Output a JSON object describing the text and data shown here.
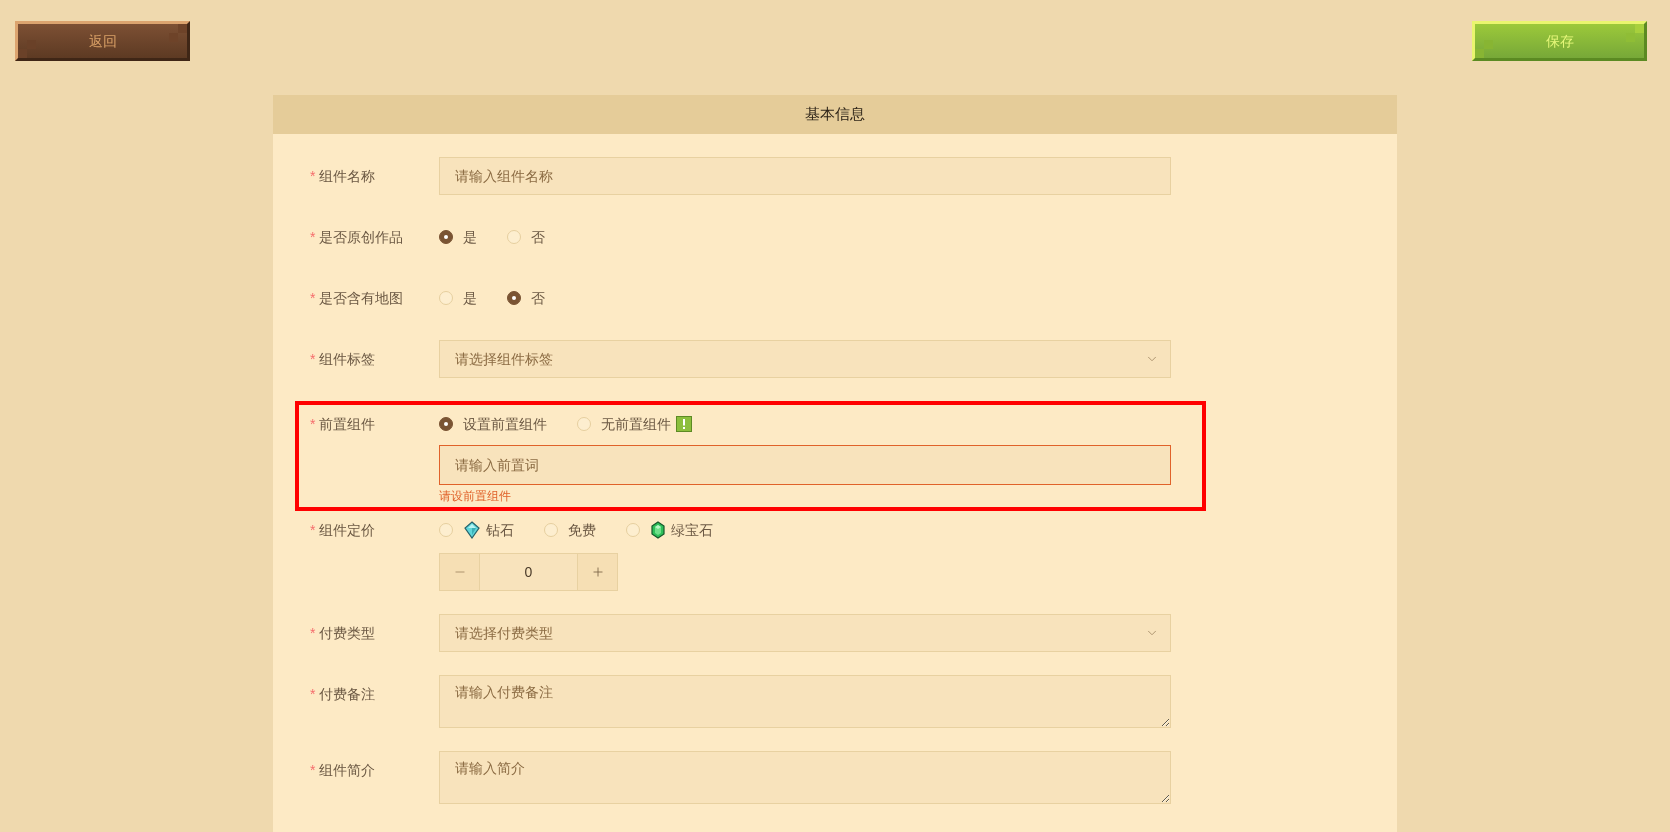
{
  "top_bar": {
    "back_button": "返回",
    "save_button": "保存"
  },
  "panel": {
    "title": "基本信息",
    "fields": [
      {
        "kind": "input",
        "required_mark": "*",
        "label": "组件名称",
        "placeholder": "请输入组件名称"
      },
      {
        "kind": "radio",
        "required_mark": "*",
        "label": "是否原创作品",
        "options": [
          {
            "kind": "plain",
            "label": "是",
            "selected": true
          },
          {
            "kind": "plain",
            "label": "否",
            "selected": false
          }
        ]
      },
      {
        "kind": "radio",
        "required_mark": "*",
        "label": "是否含有地图",
        "options": [
          {
            "kind": "plain",
            "label": "是",
            "selected": false
          },
          {
            "kind": "plain",
            "label": "否",
            "selected": true
          }
        ]
      },
      {
        "kind": "select",
        "required_mark": "*",
        "label": "组件标签",
        "placeholder": "请选择组件标签"
      },
      {
        "kind": "radio_input",
        "required_mark": "*",
        "label": "前置组件",
        "highlighted": true,
        "options": [
          {
            "kind": "plain",
            "label": "设置前置组件",
            "selected": true
          },
          {
            "kind": "warning",
            "label": "无前置组件",
            "selected": false
          }
        ],
        "input": {
          "placeholder": "请输入前置词",
          "error": true
        },
        "error_message": "请设前置组件"
      },
      {
        "kind": "price",
        "required_mark": "*",
        "label": "组件定价",
        "options": [
          {
            "kind": "diamond",
            "label": "钻石",
            "selected": false
          },
          {
            "kind": "plain",
            "label": "免费",
            "selected": false
          },
          {
            "kind": "emerald",
            "label": "绿宝石",
            "selected": false
          }
        ],
        "stepper": {
          "value": "0"
        }
      },
      {
        "kind": "select",
        "required_mark": "*",
        "label": "付费类型",
        "placeholder": "请选择付费类型"
      },
      {
        "kind": "textarea",
        "required_mark": "*",
        "label": "付费备注",
        "placeholder": "请输入付费备注"
      },
      {
        "kind": "textarea",
        "required_mark": "*",
        "label": "组件简介",
        "placeholder": "请输入简介"
      }
    ]
  }
}
